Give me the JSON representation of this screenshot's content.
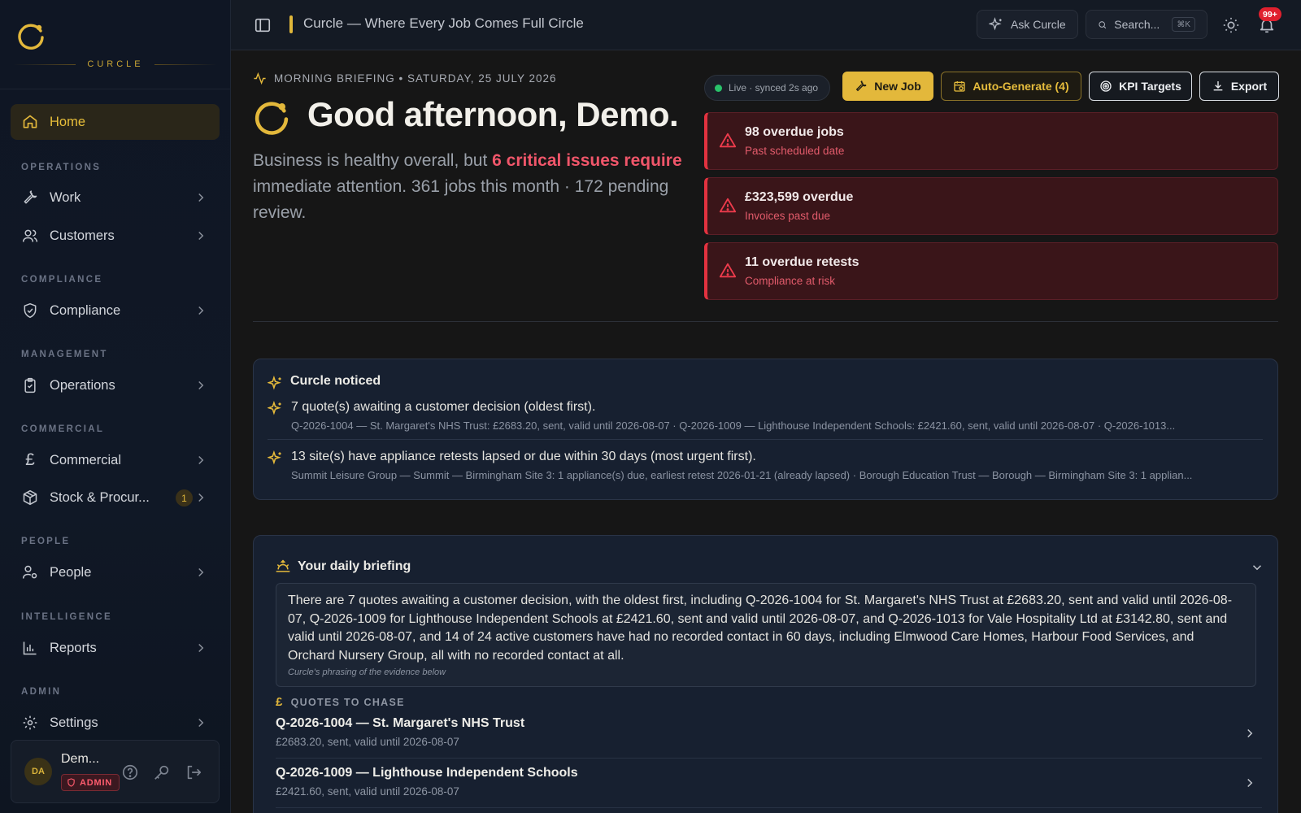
{
  "brand": {
    "wordmark": "CURCLE",
    "accent": "#e3b83b"
  },
  "sidebar": {
    "home": {
      "label": "Home",
      "icon": "home-icon"
    },
    "sections": {
      "operations": "OPERATIONS",
      "compliance": "COMPLIANCE",
      "management": "MANAGEMENT",
      "commercial": "COMMERCIAL",
      "people": "PEOPLE",
      "intelligence": "INTELLIGENCE",
      "admin": "ADMIN"
    },
    "items": {
      "work": "Work",
      "customers": "Customers",
      "compliance": "Compliance",
      "operations": "Operations",
      "commercial": "Commercial",
      "stock": "Stock & Procur...",
      "stock_badge": "1",
      "people": "People",
      "reports": "Reports",
      "settings": "Settings"
    },
    "user": {
      "initials": "DA",
      "name": "Dem...",
      "role": "ADMIN"
    }
  },
  "topbar": {
    "title": "Curcle — Where Every Job Comes Full Circle",
    "ask": "Ask Curcle",
    "search_placeholder": "Search...",
    "search_shortcut": "⌘K",
    "notifications": "99+"
  },
  "hero": {
    "briefing_label": "MORNING BRIEFING • SATURDAY, 25 JULY 2026",
    "greeting": "Good afternoon, Demo.",
    "summary_pre": "Business is healthy overall, but ",
    "summary_crit": "6 critical issues require",
    "summary_post": " immediate attention. 361 jobs this month · 172 pending review."
  },
  "actions": {
    "status": "Live · synced 2s ago",
    "new_job": "New Job",
    "auto_generate": "Auto-Generate (4)",
    "kpi": "KPI Targets",
    "export": "Export"
  },
  "alerts": [
    {
      "title": "98 overdue jobs",
      "sub": "Past scheduled date"
    },
    {
      "title": "£323,599 overdue",
      "sub": "Invoices past due"
    },
    {
      "title": "11 overdue retests",
      "sub": "Compliance at risk"
    }
  ],
  "noticed": {
    "title": "Curcle noticed",
    "items": [
      {
        "text": "7 quote(s) awaiting a customer decision (oldest first).",
        "detail": "Q-2026-1004 — St. Margaret's NHS Trust: £2683.20, sent, valid until 2026-08-07 · Q-2026-1009 — Lighthouse Independent Schools: £2421.60, sent, valid until 2026-08-07 · Q-2026-1013..."
      },
      {
        "text": "13 site(s) have appliance retests lapsed or due within 30 days (most urgent first).",
        "detail": "Summit Leisure Group — Summit — Birmingham Site 3: 1 appliance(s) due, earliest retest 2026-01-21 (already lapsed) · Borough Education Trust — Borough — Birmingham Site 3: 1 applian..."
      }
    ]
  },
  "daily": {
    "title": "Your daily briefing",
    "body": "There are 7 quotes awaiting a customer decision, with the oldest first, including Q-2026-1004 for St. Margaret's NHS Trust at £2683.20, sent and valid until 2026-08-07, Q-2026-1009 for Lighthouse Independent Schools at £2421.60, sent and valid until 2026-08-07, and Q-2026-1013 for Vale Hospitality Ltd at £3142.80, sent and valid until 2026-08-07, and 14 of 24 active customers have had no recorded contact in 60 days, including Elmwood Care Homes, Harbour Food Services, and Orchard Nursery Group, all with no recorded contact at all.",
    "caption": "Curcle's phrasing of the evidence below",
    "section_label": "QUOTES TO CHASE",
    "quotes": [
      {
        "title": "Q-2026-1004 — St. Margaret's NHS Trust",
        "sub": "£2683.20, sent, valid until 2026-08-07"
      },
      {
        "title": "Q-2026-1009 — Lighthouse Independent Schools",
        "sub": "£2421.60, sent, valid until 2026-08-07"
      }
    ]
  }
}
